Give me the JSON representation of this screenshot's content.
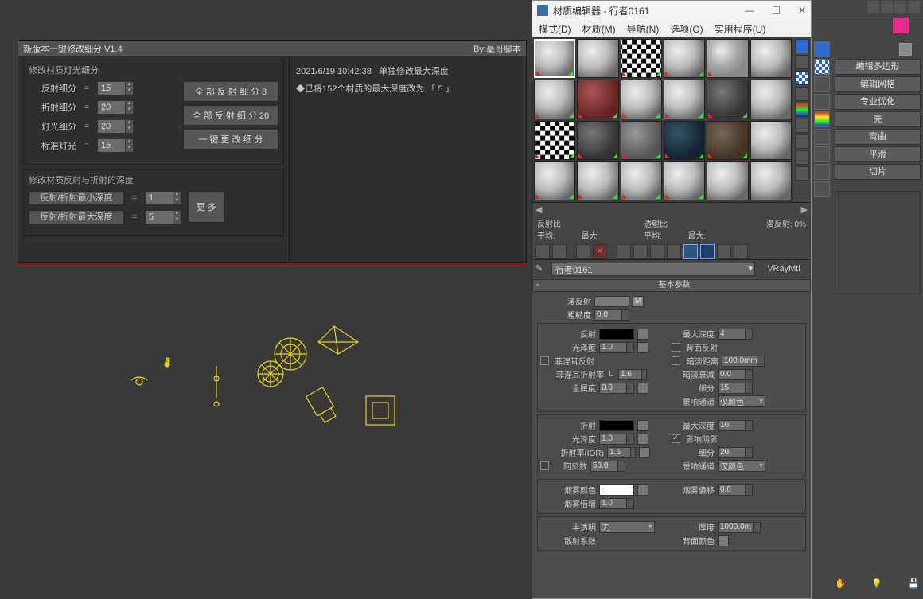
{
  "rightStrip": {
    "buttons": [
      "编辑多边形",
      "编辑网格",
      "专业优化",
      "壳",
      "弯曲",
      "平滑",
      "切片"
    ]
  },
  "scriptPanel": {
    "title": "新版本一键修改细分 V1.4",
    "author": "By:毫哥脚本",
    "group1": {
      "title": "修改材质灯光细分",
      "reflectLabel": "反射细分",
      "reflectVal": "15",
      "refractLabel": "折射细分",
      "refractVal": "20",
      "lightLabel": "灯光细分",
      "lightVal": "20",
      "stdLightLabel": "标准灯光",
      "stdLightVal": "15",
      "btnAllReflect": "全 部 反 射 细 分 8",
      "btnAllReflect20": "全 部 反 射 细 分 20",
      "btnOneKey": "一 键 更 改 细 分"
    },
    "group2": {
      "title": "修改材质反射与折射的深度",
      "minLabel": "反射/折射最小深度",
      "minVal": "1",
      "maxLabel": "反射/折射最大深度",
      "maxVal": "5",
      "btnMore": "更 多"
    },
    "log": {
      "time": "2021/6/19 10:42:38",
      "msg1": "单独修改最大深度",
      "msg2": "◆已将152个材质的最大深度改为 「 5 」"
    }
  },
  "matEditor": {
    "title": "材质编辑器 - 行者0161",
    "menu": [
      "模式(D)",
      "材质(M)",
      "导航(N)",
      "选项(O)",
      "实用程序(U)"
    ],
    "stats": {
      "reflectRatio": "反射比",
      "transRatio": "透射比",
      "avg": "平均:",
      "max": "最大:",
      "avg2": "平均:",
      "max2": "最大:",
      "diffuse": "漫反射:",
      "pct": "0%"
    },
    "name": "行者0161",
    "type": "VRayMtl",
    "basicHeader": "基本参数",
    "diffuseLbl": "漫反射",
    "mBtn": "M",
    "roughLbl": "粗糙度",
    "roughVal": "0.0",
    "reflect": {
      "lbl": "反射",
      "gloss": "光泽度",
      "glossVal": "1.0",
      "fresnel": "菲涅耳反射",
      "fresnelIOR": "菲涅耳折射率",
      "fresnelL": "L",
      "fresnelVal": "1.6",
      "metal": "金属度",
      "metalVal": "0.0",
      "maxDepth": "最大深度",
      "maxDepthVal": "4",
      "backRef": "背面反射",
      "dimDist": "暗淡距离",
      "dimDistVal": "100.0mm",
      "dimDecay": "暗淡衰减",
      "dimDecayVal": "0.0",
      "subdiv": "细分",
      "subdivVal": "15",
      "affect": "景响通道",
      "affectVal": "仅颜色"
    },
    "refract": {
      "lbl": "折射",
      "gloss": "光泽度",
      "glossVal": "1.0",
      "ior": "折射率(IOR)",
      "iorVal": "1.6",
      "abbe": "阿贝数",
      "abbeVal": "50.0",
      "maxDepth": "最大深度",
      "maxDepthVal": "10",
      "shadow": "影响阴影",
      "subdiv": "细分",
      "subdivVal": "20",
      "affect": "景响通道",
      "affectVal": "仅颜色"
    },
    "fog": {
      "color": "烟雾颜色",
      "mult": "烟雾倍增",
      "multVal": "1.0",
      "bias": "烟雾偏移",
      "biasVal": "0.0"
    },
    "trans": {
      "lbl": "半透明",
      "type": "无",
      "thick": "厚度",
      "thickVal": "1000.0m",
      "scatter": "散射系数",
      "backColor": "背面颜色"
    }
  }
}
